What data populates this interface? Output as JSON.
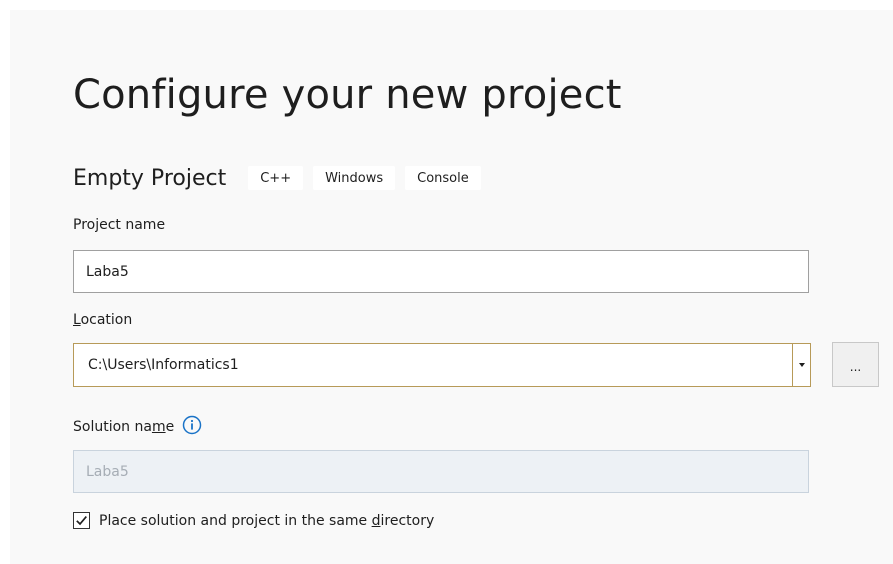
{
  "page": {
    "title": "Configure your new project"
  },
  "template": {
    "name": "Empty Project",
    "tags": [
      "C++",
      "Windows",
      "Console"
    ]
  },
  "project_name": {
    "label": "Project name",
    "value": "Laba5"
  },
  "location": {
    "label_mnemonic": "L",
    "label_rest": "ocation",
    "value": "C:\\Users\\Informatics1",
    "browse_label": "..."
  },
  "solution_name": {
    "label_pre": "Solution na",
    "label_mnemonic": "m",
    "label_post": "e",
    "value": "Laba5"
  },
  "same_directory": {
    "checked": true,
    "label_pre": "Place solution and project in the same ",
    "label_mnemonic": "d",
    "label_post": "irectory"
  },
  "colors": {
    "background": "#f9f9f9",
    "focus_border": "#b79a58",
    "info_icon": "#1a73c7",
    "disabled_fill": "#edf1f5"
  },
  "icons": {
    "info": "info-icon",
    "dropdown": "chevron-down-icon",
    "check": "checkmark-icon"
  }
}
